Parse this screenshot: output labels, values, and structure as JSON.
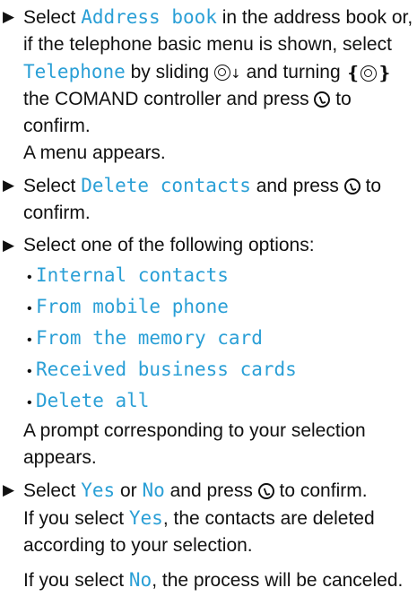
{
  "colors": {
    "text": "#111111",
    "command": "#2a9fd6",
    "background": "#ffffff"
  },
  "icons": {
    "step_marker": "right-triangle-arrow",
    "slide_down": "controller-slide-down-icon",
    "turn": "controller-turn-icon",
    "press": "controller-press-icon"
  },
  "steps": [
    {
      "parts": {
        "t1": "Select ",
        "c1": "Address book",
        "t2": " in the address book or, if the telephone basic menu is shown, select ",
        "c2": "Telephone",
        "t3": " by sliding ",
        "t4": " and turning ",
        "t5": " the COMAND controller and press ",
        "t6": " to confirm."
      },
      "result": "A menu appears."
    },
    {
      "parts": {
        "t1": "Select ",
        "c1": "Delete contacts",
        "t2": " and press ",
        "t3": " to confirm."
      }
    },
    {
      "parts": {
        "t1": "Select one of the following options:"
      },
      "options": [
        "Internal contacts",
        "From mobile phone",
        "From the memory card",
        "Received business cards",
        "Delete all"
      ],
      "result": "A prompt corresponding to your selection appears."
    },
    {
      "parts": {
        "t1": "Select ",
        "c1": "Yes",
        "t2": " or ",
        "c2": "No",
        "t3": " and press ",
        "t4": " to confirm."
      },
      "result_yes": {
        "t1": "If you select ",
        "c1": "Yes",
        "t2": ", the contacts are deleted according to your selection."
      },
      "result_no": {
        "t1": "If you select ",
        "c1": "No",
        "t2": ", the process will be canceled."
      }
    }
  ]
}
